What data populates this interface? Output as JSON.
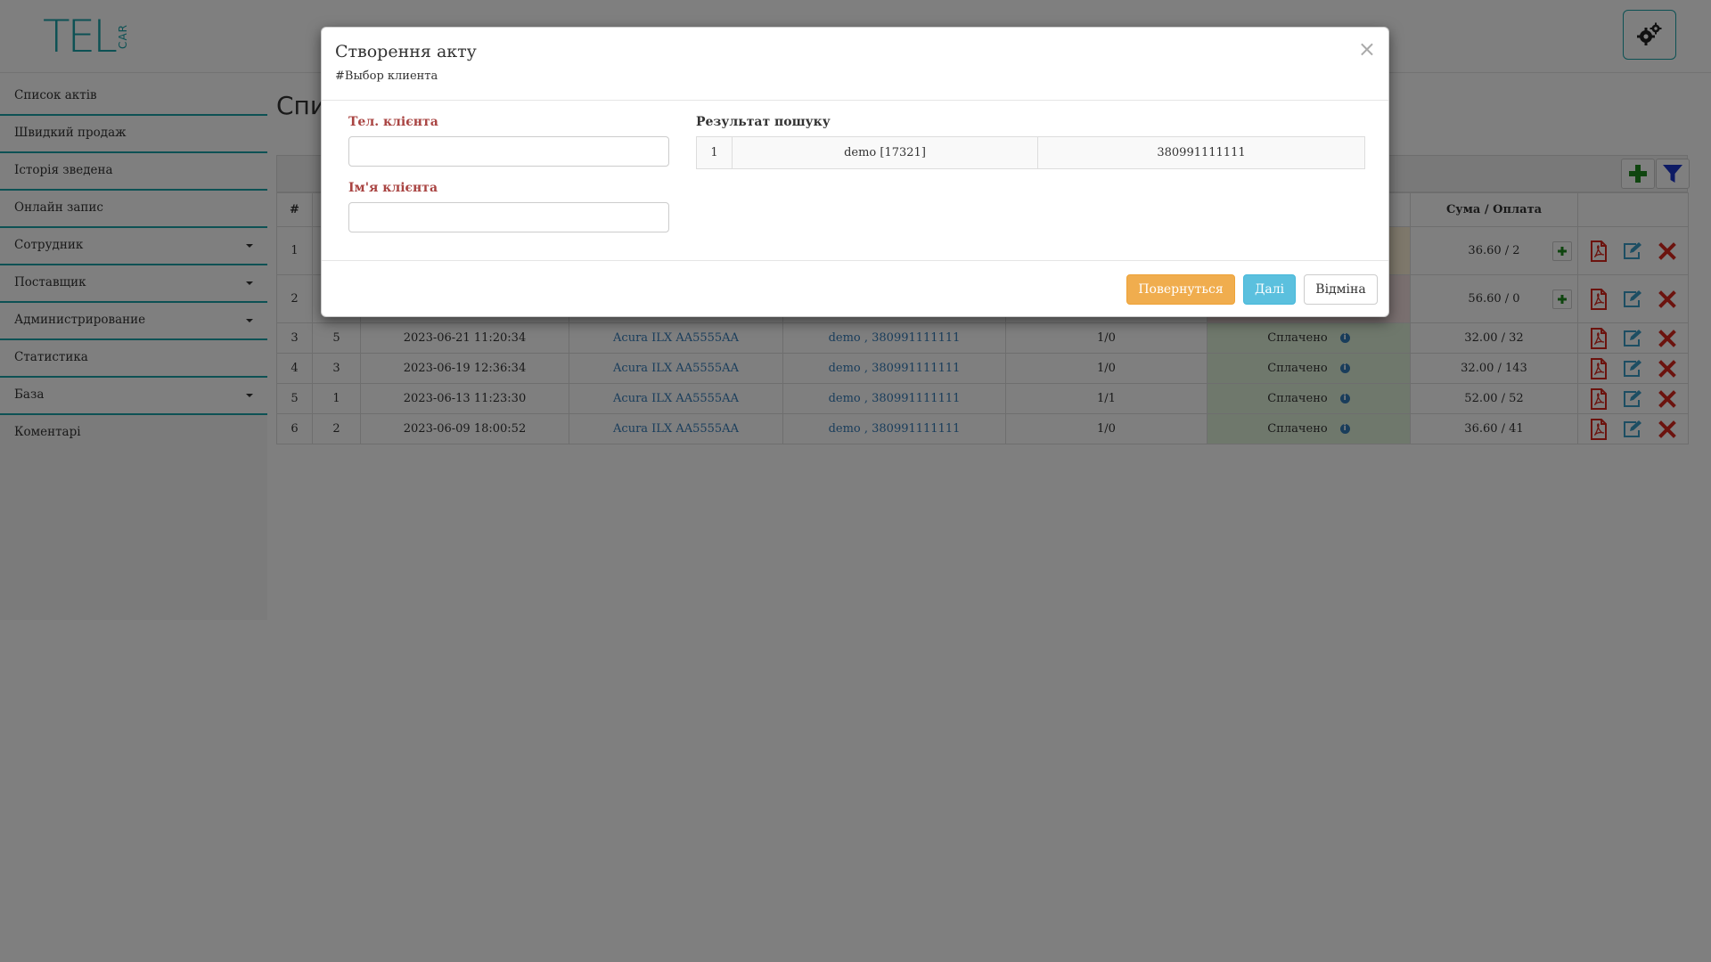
{
  "app": {
    "logo_main": "TEL",
    "logo_sub": "CAR"
  },
  "sidebar": {
    "items": [
      {
        "label": "Список актів",
        "dropdown": false
      },
      {
        "label": "Швидкий продаж",
        "dropdown": false
      },
      {
        "label": "Історія зведена",
        "dropdown": false
      },
      {
        "label": "Онлайн запис",
        "dropdown": false
      },
      {
        "label": "Сотрудник",
        "dropdown": true
      },
      {
        "label": "Поставщик",
        "dropdown": true
      },
      {
        "label": "Администрирование",
        "dropdown": true
      },
      {
        "label": "Статистика",
        "dropdown": false
      },
      {
        "label": "База",
        "dropdown": true
      },
      {
        "label": "Коментарі",
        "dropdown": false
      }
    ]
  },
  "main": {
    "page_title": "Спи",
    "table": {
      "header_index": "#",
      "header_sum": "Сума / Оплата",
      "rows": [
        {
          "idx": "1",
          "sum": "36.60 / 2",
          "status_class": "partial",
          "has_add": true
        },
        {
          "idx": "2",
          "sum": "56.60 / 0",
          "status_class": "unpaid",
          "has_add": true
        },
        {
          "idx": "3",
          "num": "5",
          "date": "2023-06-21 11:20:34",
          "car": "Acura ILX AA5555AA",
          "client": "demo , 380991111111",
          "qty": "1/0",
          "status": "Сплачено",
          "status_class": "paid",
          "sum": "32.00 / 32",
          "has_add": false
        },
        {
          "idx": "4",
          "num": "3",
          "date": "2023-06-19 12:36:34",
          "car": "Acura ILX AA5555AA",
          "client": "demo , 380991111111",
          "qty": "1/0",
          "status": "Сплачено",
          "status_class": "paid",
          "sum": "32.00 / 143",
          "has_add": false
        },
        {
          "idx": "5",
          "num": "1",
          "date": "2023-06-13 11:23:30",
          "car": "Acura ILX AA5555AA",
          "client": "demo , 380991111111",
          "qty": "1/1",
          "status": "Сплачено",
          "status_class": "paid",
          "sum": "52.00 / 52",
          "has_add": false
        },
        {
          "idx": "6",
          "num": "2",
          "date": "2023-06-09 18:00:52",
          "car": "Acura ILX AA5555AA",
          "client": "demo , 380991111111",
          "qty": "1/0",
          "status": "Сплачено",
          "status_class": "paid",
          "sum": "36.60 / 41",
          "has_add": false
        }
      ]
    }
  },
  "modal": {
    "title": "Створення акту",
    "subtitle": "#Выбор клиента",
    "phone_label": "Тел. клієнта",
    "phone_value": "",
    "name_label": "Ім'я клієнта",
    "name_value": "",
    "result_label": "Результат пошуку",
    "results": [
      {
        "index": "1",
        "name": "demo [17321]",
        "phone": "380991111111"
      }
    ],
    "buttons": {
      "back": "Повернуться",
      "next": "Далі",
      "cancel": "Відміна"
    }
  },
  "colors": {
    "brand": "#1aa3a8",
    "link": "#337ab7",
    "warning": "#f0ad4e",
    "info": "#5bc0de",
    "danger": "#d9261c",
    "pdf": "#d9261c",
    "add": "#1f8a1f",
    "filter": "#1a35c9"
  },
  "icons": {
    "settings": "gears-icon",
    "add": "plus-icon",
    "filter": "filter-icon",
    "pdf": "pdf-file-icon",
    "edit": "edit-icon",
    "delete": "delete-x-icon",
    "info": "info-icon",
    "close": "close-icon"
  }
}
